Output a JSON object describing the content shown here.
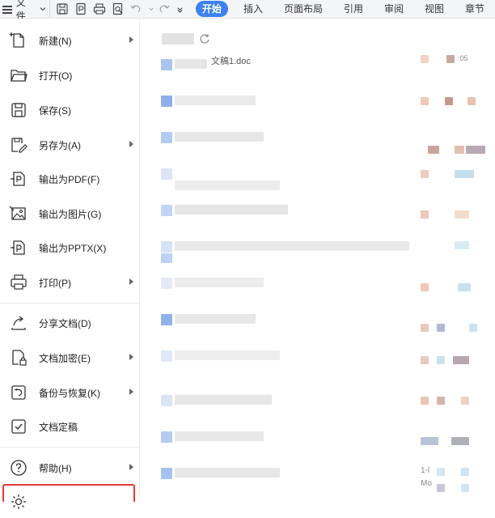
{
  "toolbar": {
    "file_label": "文件",
    "quick_access": [
      {
        "icon": "save-icon"
      },
      {
        "icon": "export-pdf-icon"
      },
      {
        "icon": "print-icon"
      },
      {
        "icon": "print-preview-icon"
      },
      {
        "icon": "undo-icon"
      },
      {
        "icon": "redo-icon"
      },
      {
        "icon": "customize-dropdown-icon"
      }
    ],
    "tabs": [
      "开始",
      "插入",
      "页面布局",
      "引用",
      "审阅",
      "视图",
      "章节"
    ],
    "active_tab": "开始",
    "accent_color": "#3d82f0"
  },
  "menu": {
    "items": [
      {
        "label": "新建(N)",
        "icon": "new-document-icon",
        "submenu": true
      },
      {
        "label": "打开(O)",
        "icon": "folder-open-icon",
        "submenu": false
      },
      {
        "label": "保存(S)",
        "icon": "save-icon",
        "submenu": false
      },
      {
        "label": "另存为(A)",
        "icon": "save-as-icon",
        "submenu": true
      },
      {
        "label": "输出为PDF(F)",
        "icon": "export-pdf-icon",
        "submenu": false
      },
      {
        "label": "输出为图片(G)",
        "icon": "export-image-icon",
        "submenu": false
      },
      {
        "label": "输出为PPTX(X)",
        "icon": "export-pptx-icon",
        "submenu": false
      },
      {
        "label": "打印(P)",
        "icon": "print-icon",
        "submenu": true
      },
      {
        "label": "分享文档(D)",
        "icon": "share-icon",
        "submenu": false
      },
      {
        "label": "文档加密(E)",
        "icon": "encrypt-document-icon",
        "submenu": true
      },
      {
        "label": "备份与恢复(K)",
        "icon": "backup-restore-icon",
        "submenu": true
      },
      {
        "label": "文档定稿",
        "icon": "finalize-document-icon",
        "submenu": false
      },
      {
        "label": "帮助(H)",
        "icon": "help-icon",
        "submenu": true
      }
    ],
    "highlight_color": "#e53935"
  },
  "recent": {
    "visible_file_name": "文稿1.doc",
    "visible_time_fragment": ":05",
    "partial_texts": [
      "1-l",
      "Mo"
    ]
  }
}
